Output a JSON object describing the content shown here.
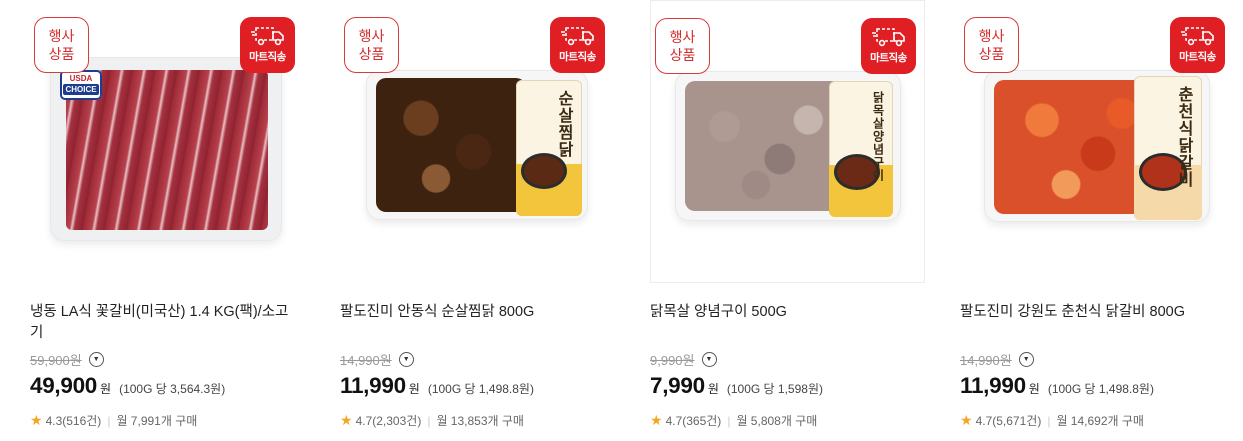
{
  "colors": {
    "accent_red": "#e01f25",
    "event_border": "#d93a3a",
    "star": "#f3a71d"
  },
  "products": [
    {
      "event_badge": [
        "행사",
        "상품"
      ],
      "ship_badge": "마트직송",
      "usda_label": [
        "USDA",
        "CHOICE"
      ],
      "name_lines": [
        "냉동 LA식 꽃갈비(미국산) 1.4 KG(팩)/소고",
        "기"
      ],
      "original_price": "59,900",
      "original_price_unit": "원",
      "sale_price": "49,900",
      "sale_price_unit": "원",
      "unit_price": "(100G 당 3,564.3원)",
      "rating": "4.3",
      "review_count": "(516건)",
      "monthly_purchase": "월 7,991개 구매"
    },
    {
      "event_badge": [
        "행사",
        "상품"
      ],
      "ship_badge": "마트직송",
      "package_title": "순살찜닭",
      "name_lines": [
        "팔도진미 안동식 순살찜닭 800G"
      ],
      "original_price": "14,990",
      "original_price_unit": "원",
      "sale_price": "11,990",
      "sale_price_unit": "원",
      "unit_price": "(100G 당 1,498.8원)",
      "rating": "4.7",
      "review_count": "(2,303건)",
      "monthly_purchase": "월 13,853개 구매"
    },
    {
      "event_badge": [
        "행사",
        "상품"
      ],
      "ship_badge": "마트직송",
      "package_title": "닭목살양념구이",
      "name_lines": [
        "닭목살 양념구이 500G"
      ],
      "original_price": "9,990",
      "original_price_unit": "원",
      "sale_price": "7,990",
      "sale_price_unit": "원",
      "unit_price": "(100G 당 1,598원)",
      "rating": "4.7",
      "review_count": "(365건)",
      "monthly_purchase": "월 5,808개 구매"
    },
    {
      "event_badge": [
        "행사",
        "상품"
      ],
      "ship_badge": "마트직송",
      "package_title": "춘천식닭갈비",
      "name_lines": [
        "팔도진미 강원도 춘천식 닭갈비 800G"
      ],
      "original_price": "14,990",
      "original_price_unit": "원",
      "sale_price": "11,990",
      "sale_price_unit": "원",
      "unit_price": "(100G 당 1,498.8원)",
      "rating": "4.7",
      "review_count": "(5,671건)",
      "monthly_purchase": "월 14,692개 구매"
    }
  ]
}
